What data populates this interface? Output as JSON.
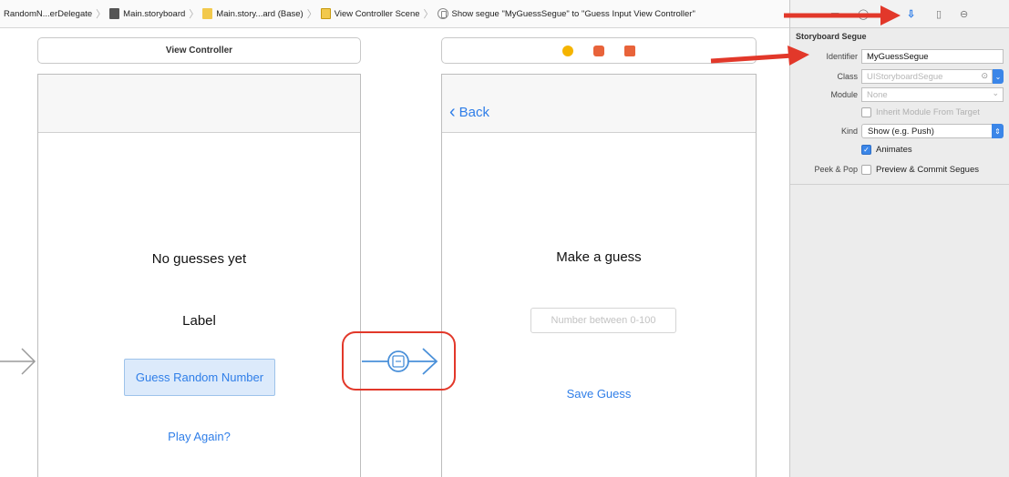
{
  "breadcrumb": [
    {
      "label": "RandomN...erDelegate",
      "icon": "file-icon"
    },
    {
      "label": "Main.storyboard",
      "icon": "storyboard-icon"
    },
    {
      "label": "Main.story...ard (Base)",
      "icon": "storyboard-icon"
    },
    {
      "label": "View Controller Scene",
      "icon": "scene-icon"
    },
    {
      "label": "Show segue \"MyGuessSegue\" to \"Guess Input View Controller\"",
      "icon": "segue-icon"
    }
  ],
  "left_scene": {
    "title": "View Controller",
    "status_label": "No guesses yet",
    "label": "Label",
    "guess_button": "Guess Random Number",
    "play_again": "Play Again?"
  },
  "right_scene": {
    "back_label": "Back",
    "prompt": "Make a guess",
    "input_placeholder": "Number between 0-100",
    "save_button": "Save Guess",
    "title_bar_icons": [
      "view-controller-icon",
      "first-responder-icon",
      "exit-icon"
    ]
  },
  "inspector": {
    "section_title": "Storyboard Segue",
    "identifier_label": "Identifier",
    "identifier_value": "MyGuessSegue",
    "class_label": "Class",
    "class_placeholder": "UIStoryboardSegue",
    "module_label": "Module",
    "module_placeholder": "None",
    "inherit_module": "Inherit Module From Target",
    "kind_label": "Kind",
    "kind_value": "Show (e.g. Push)",
    "animates": "Animates",
    "peek_pop_label": "Peek & Pop",
    "preview_commit": "Preview & Commit Segues",
    "tabs": [
      "file-inspector-icon",
      "help-icon",
      "attributes-inspector-icon",
      "size-inspector-icon",
      "connections-inspector-icon"
    ]
  },
  "colors": {
    "accent": "#2f7ee8",
    "annotation": "#e2382a",
    "checkbox": "#3b86e8",
    "segue": "#4a90d9"
  }
}
